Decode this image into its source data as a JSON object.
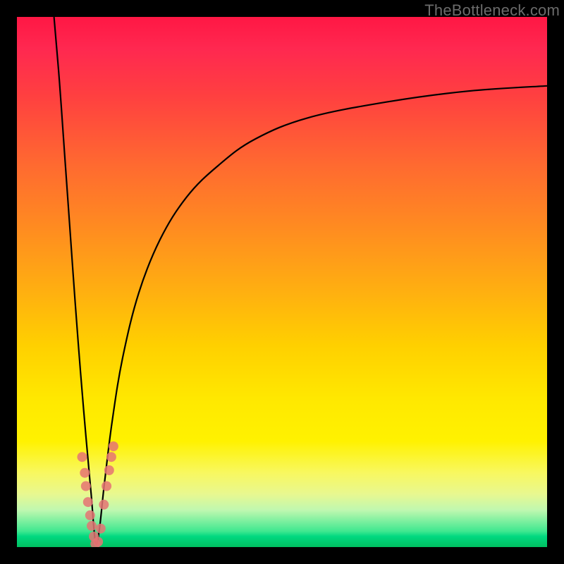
{
  "watermark": "TheBottleneck.com",
  "colors": {
    "bg": "#000000",
    "curve": "#000000",
    "dot": "#e57373",
    "gradient_top": "#ff1744",
    "gradient_bottom": "#00c060"
  },
  "chart_data": {
    "type": "line",
    "title": "",
    "xlabel": "",
    "ylabel": "",
    "xlim": [
      0,
      100
    ],
    "ylim": [
      0,
      100
    ],
    "grid": false,
    "legend": false,
    "description": "Bottleneck percentage curve. V-shaped: steep descent from top-left near x≈7 down to 0% at x≈15, then rises sharply and tapers asymptotically toward ~87% at the right edge. Minimum (0%) is at the notch near x≈15. Background is a vertical heatmap gradient from red (high bottleneck) through orange/yellow to green (no bottleneck).",
    "series": [
      {
        "name": "bottleneck-curve",
        "x": [
          7,
          8,
          9,
          10,
          11,
          12,
          13,
          14,
          14.8,
          15.5,
          16.5,
          18,
          20,
          23,
          27,
          32,
          38,
          45,
          55,
          70,
          85,
          100
        ],
        "y": [
          100,
          88,
          74,
          60,
          46,
          33,
          21,
          10,
          1,
          3,
          12,
          24,
          36,
          48,
          58,
          66,
          72,
          77,
          81,
          84,
          86,
          87
        ]
      }
    ],
    "points": [
      {
        "x": 12.3,
        "y": 17.0
      },
      {
        "x": 12.8,
        "y": 14.0
      },
      {
        "x": 13.0,
        "y": 11.5
      },
      {
        "x": 13.4,
        "y": 8.5
      },
      {
        "x": 13.8,
        "y": 6.0
      },
      {
        "x": 14.1,
        "y": 4.0
      },
      {
        "x": 14.5,
        "y": 2.0
      },
      {
        "x": 14.8,
        "y": 0.6
      },
      {
        "x": 15.3,
        "y": 1.0
      },
      {
        "x": 15.8,
        "y": 3.5
      },
      {
        "x": 16.4,
        "y": 8.0
      },
      {
        "x": 16.9,
        "y": 11.5
      },
      {
        "x": 17.4,
        "y": 14.5
      },
      {
        "x": 17.8,
        "y": 17.0
      },
      {
        "x": 18.2,
        "y": 19.0
      }
    ]
  }
}
